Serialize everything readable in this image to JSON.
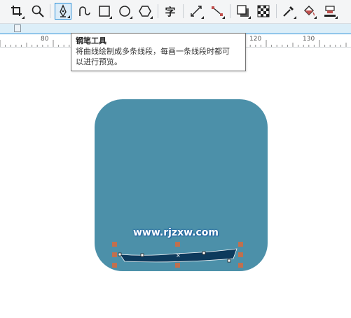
{
  "toolbar": {
    "tools": [
      {
        "name": "crop-icon"
      },
      {
        "name": "zoom-icon"
      },
      {
        "name": "pen-icon",
        "active": true
      },
      {
        "name": "bspline-icon"
      },
      {
        "name": "rectangle-icon"
      },
      {
        "name": "ellipse-icon"
      },
      {
        "name": "polygon-icon"
      },
      {
        "name": "text-tool-icon",
        "glyph": "字"
      },
      {
        "name": "dimension-icon"
      },
      {
        "name": "connector-icon"
      },
      {
        "name": "drop-shadow-icon"
      },
      {
        "name": "transparency-icon"
      },
      {
        "name": "eyedropper-icon"
      },
      {
        "name": "interactive-fill-icon"
      },
      {
        "name": "smart-fill-icon"
      }
    ],
    "text_tool_glyph": "字"
  },
  "ruler": {
    "labels": [
      "80",
      "120",
      "130"
    ]
  },
  "tooltip": {
    "title": "钢笔工具",
    "line1": "将曲线绘制成多条线段，每画一条线段时都可",
    "line2": "以进行预览。"
  },
  "canvas": {
    "shape_fill": "#4c90a9",
    "path_fill": "#0d3a5c",
    "handle_color": "#c0704f",
    "watermark": "www.rjzxw.com"
  },
  "colors": {
    "accent": "#2a8fd8",
    "toolbar_bg": "#f4f5f6"
  }
}
